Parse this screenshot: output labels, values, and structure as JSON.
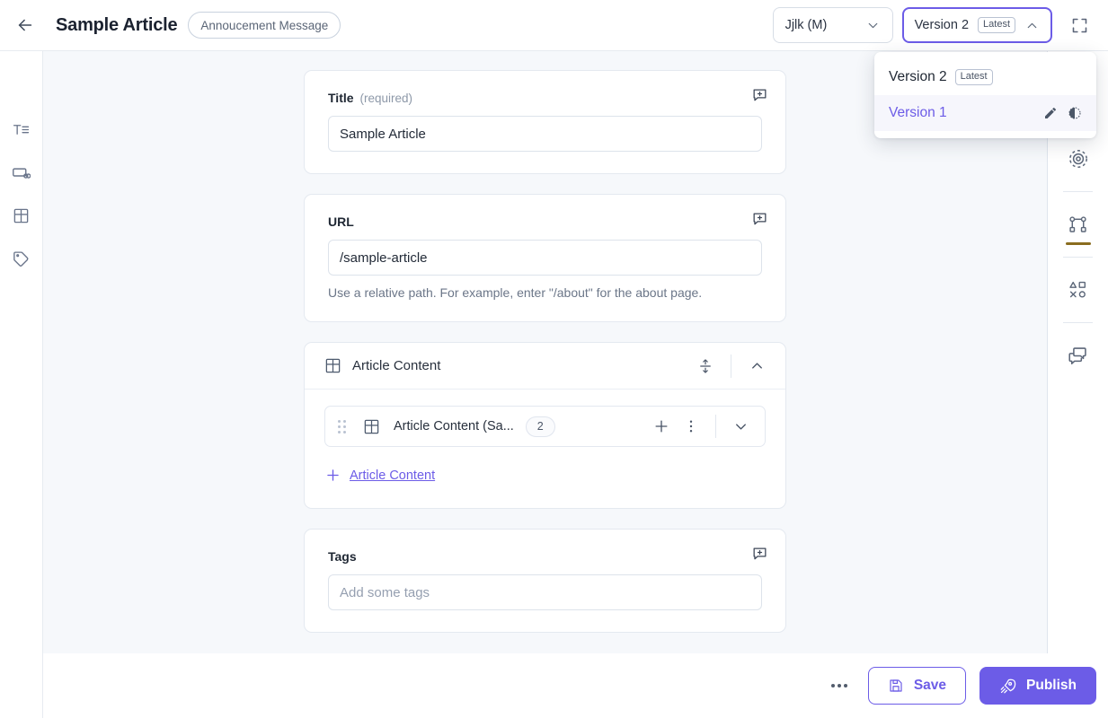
{
  "header": {
    "back_icon": "arrow-left-icon",
    "title": "Sample Article",
    "type_badge": "Annoucement Message",
    "locale_select": {
      "value": "Jjlk (M)",
      "chevron_icon": "chevron-down-icon"
    },
    "version_select": {
      "value": "Version 2",
      "chip": "Latest",
      "chevron_icon": "chevron-up-icon",
      "open": true
    },
    "fullscreen_icon": "fullscreen-icon"
  },
  "version_menu": {
    "items": [
      {
        "label": "Version 2",
        "chip": "Latest",
        "selected": false,
        "actions": []
      },
      {
        "label": "Version 1",
        "chip": "",
        "selected": true,
        "actions": [
          "pencil-icon",
          "contrast-icon"
        ]
      }
    ]
  },
  "left_rail": {
    "items": [
      {
        "icon": "text-title-icon",
        "name": "sidebar-item-title"
      },
      {
        "icon": "url-slug-icon",
        "name": "sidebar-item-url"
      },
      {
        "icon": "grid-content-icon",
        "name": "sidebar-item-content"
      },
      {
        "icon": "tag-icon",
        "name": "sidebar-item-tags"
      }
    ]
  },
  "right_rail": {
    "items": [
      {
        "icon": "target-icon",
        "name": "rail-item-preview",
        "active": false
      },
      {
        "icon": "node-graph-icon",
        "name": "rail-item-relations",
        "active": true
      },
      {
        "icon": "shapes-icon",
        "name": "rail-item-components",
        "active": false
      },
      {
        "icon": "comments-icon",
        "name": "rail-item-comments",
        "active": false
      }
    ],
    "active_underline_color": "#8a6d1f"
  },
  "fields": {
    "title": {
      "label": "Title",
      "hint": "(required)",
      "value": "Sample Article",
      "comment_icon": "add-comment-icon"
    },
    "url": {
      "label": "URL",
      "value": "/sample-article",
      "help": "Use a relative path. For example, enter \"/about\" for the about page.",
      "comment_icon": "add-comment-icon"
    },
    "tags": {
      "label": "Tags",
      "placeholder": "Add some tags",
      "value": "",
      "comment_icon": "add-comment-icon"
    }
  },
  "article_content": {
    "section_title": "Article Content",
    "section_icon": "grid-content-icon",
    "reorder_icon": "sort-vertical-icon",
    "collapse_icon": "chevron-up-icon",
    "items": [
      {
        "drag_icon": "drag-handle-icon",
        "icon": "grid-content-icon",
        "label": "Article Content (Sa...",
        "count": "2",
        "add_icon": "plus-icon",
        "menu_icon": "kebab-menu-icon",
        "expand_icon": "chevron-down-icon"
      }
    ],
    "add_link": {
      "icon": "plus-icon",
      "label": "Article Content"
    }
  },
  "bottom_bar": {
    "more_icon": "more-horizontal-icon",
    "save": {
      "label": "Save",
      "icon": "save-disk-icon"
    },
    "publish": {
      "label": "Publish",
      "icon": "rocket-icon"
    }
  },
  "colors": {
    "accent": "#6c5ce7",
    "canvas_bg": "#f6f8fb",
    "panel_bg": "#ffffff",
    "text": "#1f2733",
    "muted": "#8d98a8",
    "active_underline": "#8a6d1f"
  }
}
